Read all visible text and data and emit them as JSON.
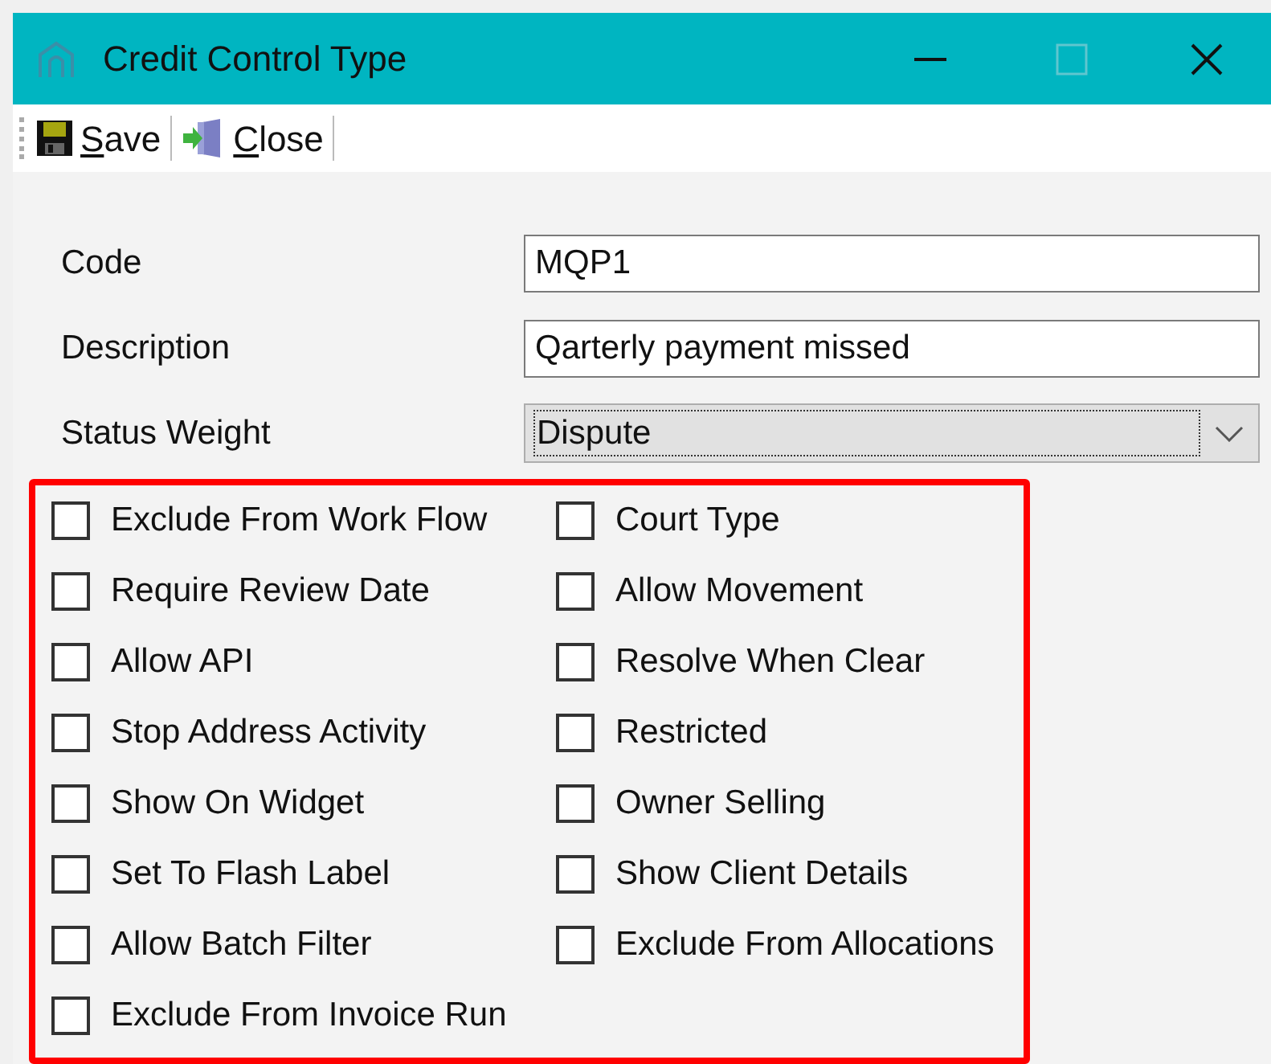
{
  "window": {
    "title": "Credit Control Type"
  },
  "toolbar": [
    {
      "kind": "save",
      "label": "Save"
    },
    {
      "kind": "close",
      "label": "Close"
    }
  ],
  "fields": [
    {
      "kind": "text",
      "label": "Code",
      "value": "MQP1"
    },
    {
      "kind": "text",
      "label": "Description",
      "value": "Qarterly payment missed"
    },
    {
      "kind": "select",
      "label": "Status Weight",
      "value": "Dispute"
    }
  ],
  "options_left": [
    {
      "label": "Exclude From Work Flow",
      "checked": false
    },
    {
      "label": "Require Review Date",
      "checked": false
    },
    {
      "label": "Allow API",
      "checked": false
    },
    {
      "label": "Stop Address Activity",
      "checked": false
    },
    {
      "label": "Show On Widget",
      "checked": false
    },
    {
      "label": "Set To Flash Label",
      "checked": false
    },
    {
      "label": "Allow Batch Filter",
      "checked": false
    },
    {
      "label": "Exclude From Invoice Run",
      "checked": false
    }
  ],
  "options_right": [
    {
      "label": "Court Type",
      "checked": false
    },
    {
      "label": "Allow Movement",
      "checked": false
    },
    {
      "label": "Resolve When Clear",
      "checked": false
    },
    {
      "label": "Restricted",
      "checked": false
    },
    {
      "label": "Owner Selling",
      "checked": false
    },
    {
      "label": "Show Client Details",
      "checked": false
    },
    {
      "label": "Exclude From Allocations",
      "checked": false
    }
  ]
}
